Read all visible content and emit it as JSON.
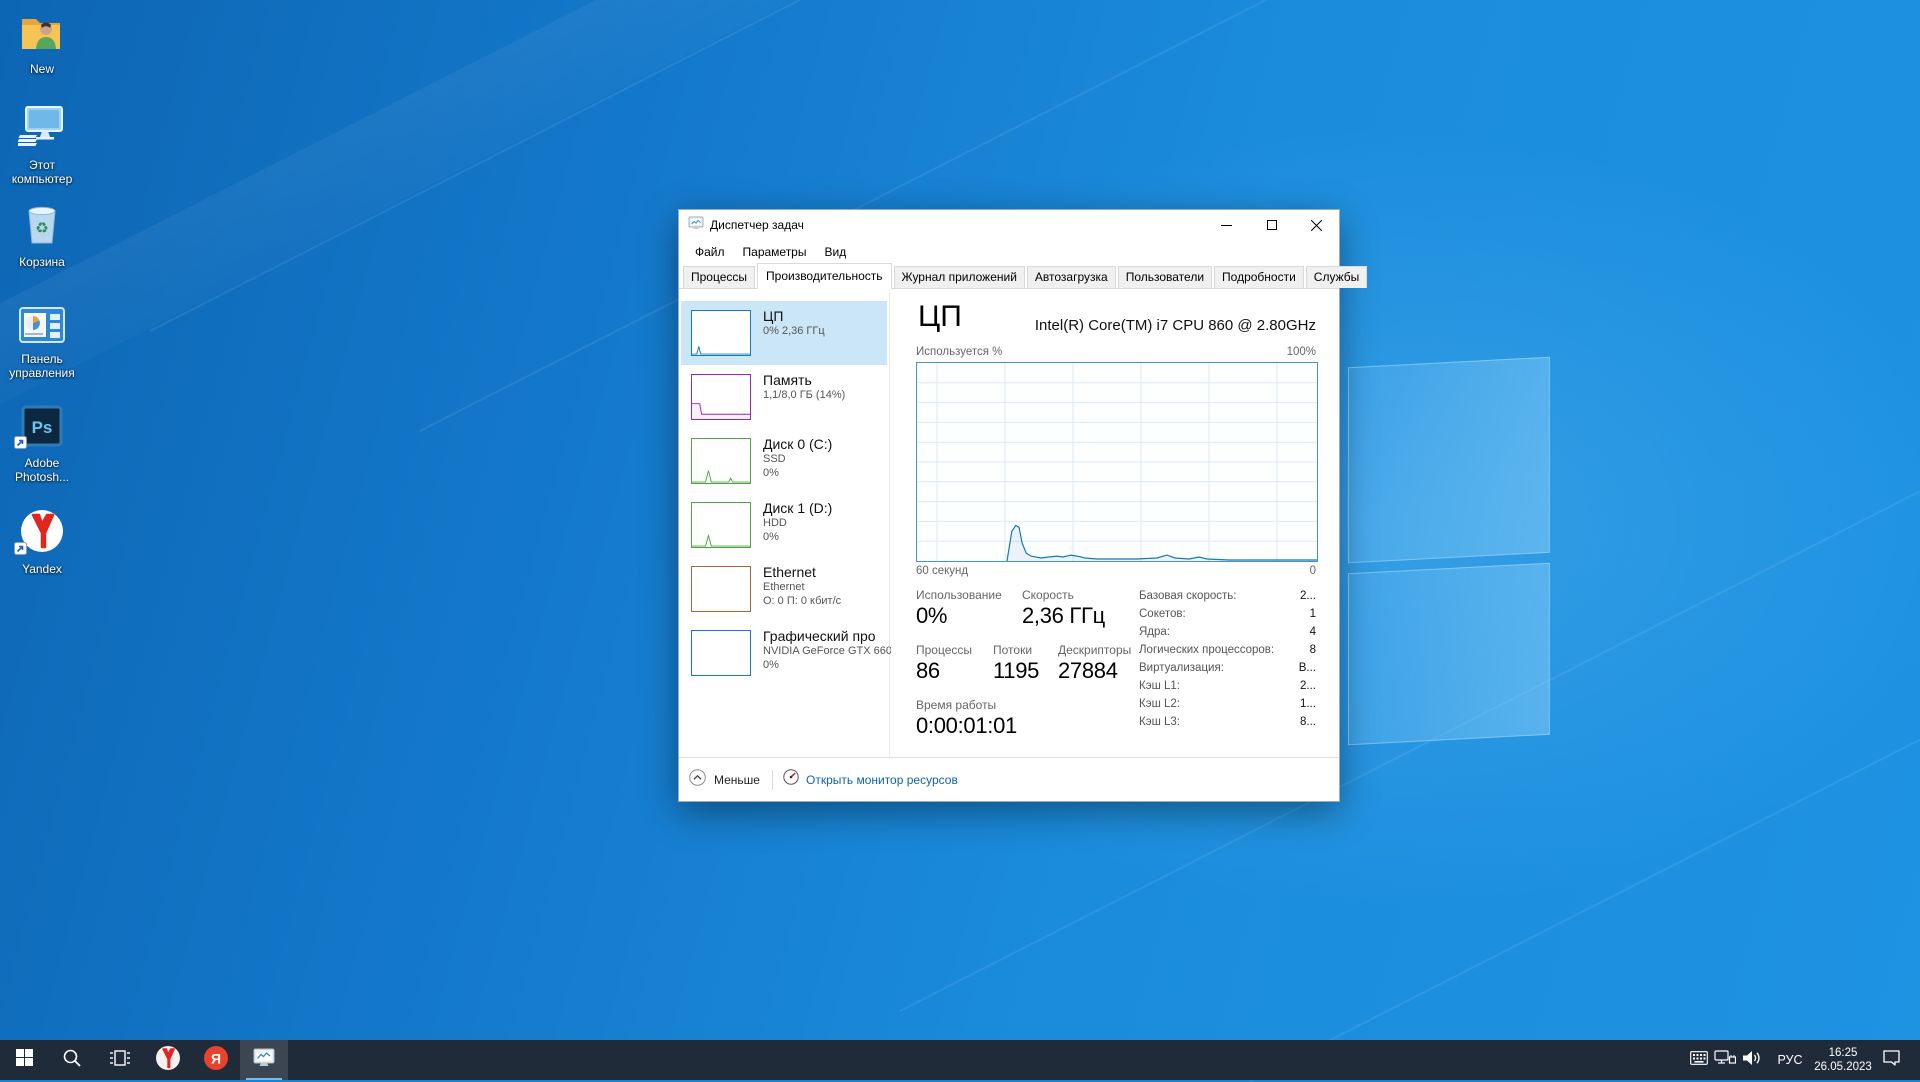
{
  "desktop": {
    "icons": [
      {
        "label": "New",
        "icon": "user-folder-icon"
      },
      {
        "label": "Этот компьютер",
        "icon": "computer-icon"
      },
      {
        "label": "Корзина",
        "icon": "recycle-bin-icon"
      },
      {
        "label": "Панель управления",
        "icon": "control-panel-icon"
      },
      {
        "label": "Adobe Photosh...",
        "icon": "photoshop-icon"
      },
      {
        "label": "Yandex",
        "icon": "yandex-icon"
      }
    ]
  },
  "taskmanager": {
    "title": "Диспетчер задач",
    "controls": [
      "minimize-icon",
      "maximize-icon",
      "close-icon"
    ],
    "menu": [
      "Файл",
      "Параметры",
      "Вид"
    ],
    "tabs": [
      "Процессы",
      "Производительность",
      "Журнал приложений",
      "Автозагрузка",
      "Пользователи",
      "Подробности",
      "Службы"
    ],
    "active_tab": "Производительность",
    "sidebar": [
      {
        "title": "ЦП",
        "line2": "0% 2,36 ГГц",
        "line3": "",
        "accent": "#117dbb",
        "selected": true
      },
      {
        "title": "Память",
        "line2": "1,1/8,0 ГБ (14%)",
        "line3": "",
        "accent": "#9b27af",
        "selected": false
      },
      {
        "title": "Диск 0 (C:)",
        "line2": "SSD",
        "line3": "0%",
        "accent": "#4ba83c",
        "selected": false
      },
      {
        "title": "Диск 1 (D:)",
        "line2": "HDD",
        "line3": "0%",
        "accent": "#4ba83c",
        "selected": false
      },
      {
        "title": "Ethernet",
        "line2": "Ethernet",
        "line3": "О: 0 П: 0 кбит/с",
        "accent": "#a5682e",
        "selected": false
      },
      {
        "title": "Графический про",
        "line2": "NVIDIA GeForce GTX 660",
        "line3": "0%",
        "accent": "#1779be",
        "selected": false
      }
    ],
    "main": {
      "heading": "ЦП",
      "subtitle": "Intel(R) Core(TM) i7 CPU 860 @ 2.80GHz",
      "graph_top_left": "Используется %",
      "graph_top_right": "100%",
      "graph_bottom_left": "60 секунд",
      "graph_bottom_right": "0",
      "stats": [
        {
          "label": "Использование",
          "value": "0%"
        },
        {
          "label": "Скорость",
          "value": "2,36 ГГц"
        },
        {
          "label": "Процессы",
          "value": "86"
        },
        {
          "label": "Потоки",
          "value": "1195"
        },
        {
          "label": "Дескрипторы",
          "value": "27884"
        },
        {
          "label": "Время работы",
          "value": "0:00:01:01"
        }
      ],
      "details": [
        {
          "label": "Базовая скорость:",
          "value": "2..."
        },
        {
          "label": "Сокетов:",
          "value": "1"
        },
        {
          "label": "Ядра:",
          "value": "4"
        },
        {
          "label": "Логических процессоров:",
          "value": "8"
        },
        {
          "label": "Виртуализация:",
          "value": "В..."
        },
        {
          "label": "Кэш L1:",
          "value": "2..."
        },
        {
          "label": "Кэш L2:",
          "value": "1..."
        },
        {
          "label": "Кэш L3:",
          "value": "8..."
        }
      ]
    },
    "footer": {
      "less_icon": "chevron-up-circle-icon",
      "less": "Меньше",
      "link_icon": "resource-monitor-icon",
      "link": "Открыть монитор ресурсов"
    }
  },
  "taskbar": {
    "buttons": [
      {
        "icon": "start-icon"
      },
      {
        "icon": "search-icon"
      },
      {
        "icon": "task-view-icon"
      },
      {
        "icon": "yandex-browser-icon"
      },
      {
        "icon": "yandex-ya-icon"
      },
      {
        "icon": "task-manager-icon",
        "active": true
      }
    ],
    "tray_icons": [
      "touch-keyboard-icon",
      "network-icon",
      "volume-icon",
      "action-center-icon"
    ],
    "language": "РУС",
    "time": "16:25",
    "date": "26.05.2023"
  },
  "chart_data": {
    "type": "area",
    "title": "ЦП — Используется %",
    "xlabel": "60 секунд → 0",
    "ylim": [
      0,
      100
    ],
    "grid": true,
    "colors": {
      "line": "#1579b5",
      "fill": "rgba(21,121,181,0.08)",
      "border": "#4a92c6",
      "grid": "#dce9f3"
    },
    "points": [
      [
        0.225,
        0
      ],
      [
        0.237,
        15
      ],
      [
        0.247,
        18
      ],
      [
        0.255,
        17
      ],
      [
        0.263,
        9
      ],
      [
        0.273,
        4
      ],
      [
        0.285,
        2.5
      ],
      [
        0.31,
        1.5
      ],
      [
        0.33,
        2
      ],
      [
        0.35,
        2.5
      ],
      [
        0.365,
        2
      ],
      [
        0.385,
        3
      ],
      [
        0.4,
        2.5
      ],
      [
        0.42,
        1.5
      ],
      [
        0.45,
        1
      ],
      [
        0.55,
        1
      ],
      [
        0.6,
        1.5
      ],
      [
        0.625,
        3
      ],
      [
        0.645,
        1.5
      ],
      [
        0.68,
        1
      ],
      [
        0.705,
        2
      ],
      [
        0.725,
        1
      ],
      [
        0.78,
        0.5
      ],
      [
        1,
        0.5
      ]
    ]
  }
}
